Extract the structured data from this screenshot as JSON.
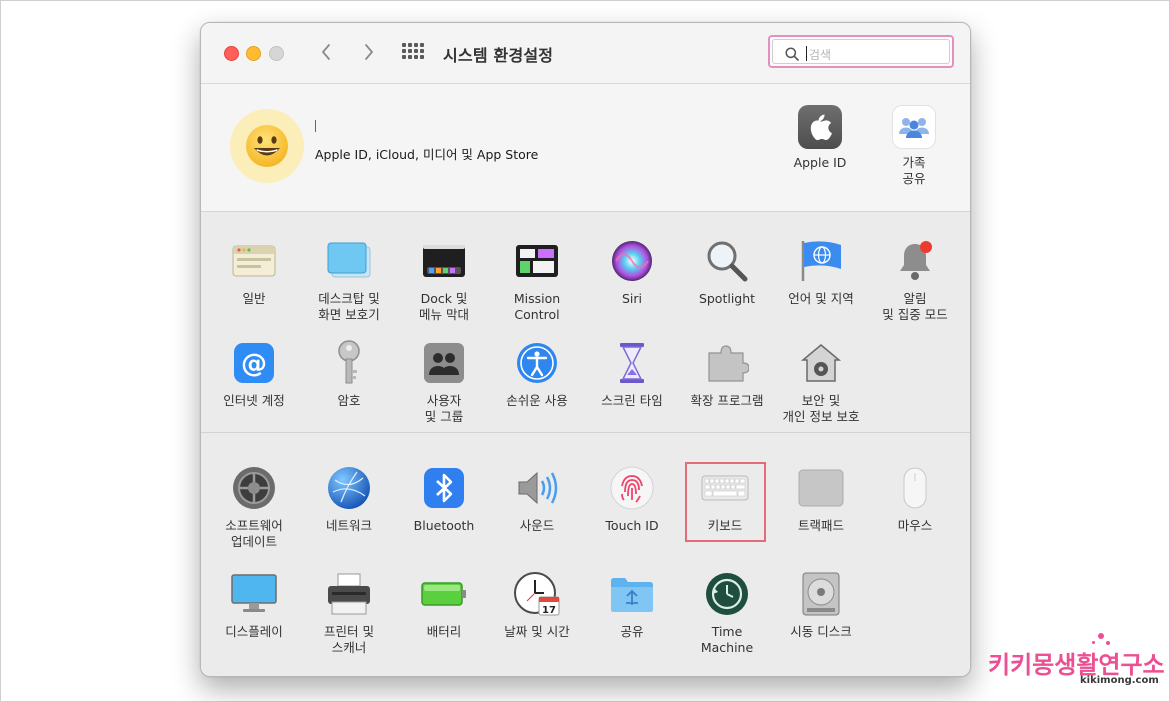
{
  "window": {
    "title": "시스템 환경설정",
    "search": {
      "placeholder": "검색",
      "value": ""
    }
  },
  "account": {
    "label": "Apple ID, iCloud, 미디어 및 App Store",
    "items": [
      {
        "label": "Apple ID",
        "icon": "apple-logo-icon"
      },
      {
        "label": "가족\n공유",
        "icon": "family-sharing-icon"
      }
    ]
  },
  "panes_row1": [
    {
      "label": "일반",
      "icon": "general-icon"
    },
    {
      "label": "데스크탑 및\n화면 보호기",
      "icon": "desktop-screensaver-icon"
    },
    {
      "label": "Dock 및\n메뉴 막대",
      "icon": "dock-menubar-icon"
    },
    {
      "label": "Mission\nControl",
      "icon": "mission-control-icon"
    },
    {
      "label": "Siri",
      "icon": "siri-icon"
    },
    {
      "label": "Spotlight",
      "icon": "spotlight-icon"
    },
    {
      "label": "언어 및 지역",
      "icon": "language-region-icon"
    },
    {
      "label": "알림\n및 집중 모드",
      "icon": "notifications-icon"
    }
  ],
  "panes_row2": [
    {
      "label": "인터넷 계정",
      "icon": "internet-accounts-icon"
    },
    {
      "label": "암호",
      "icon": "passwords-icon"
    },
    {
      "label": "사용자\n및 그룹",
      "icon": "users-groups-icon"
    },
    {
      "label": "손쉬운 사용",
      "icon": "accessibility-icon"
    },
    {
      "label": "스크린 타임",
      "icon": "screen-time-icon"
    },
    {
      "label": "확장 프로그램",
      "icon": "extensions-icon"
    },
    {
      "label": "보안 및\n개인 정보 보호",
      "icon": "security-privacy-icon"
    }
  ],
  "panes_row3": [
    {
      "label": "소프트웨어\n업데이트",
      "icon": "software-update-icon"
    },
    {
      "label": "네트워크",
      "icon": "network-icon"
    },
    {
      "label": "Bluetooth",
      "icon": "bluetooth-icon"
    },
    {
      "label": "사운드",
      "icon": "sound-icon"
    },
    {
      "label": "Touch ID",
      "icon": "touch-id-icon"
    },
    {
      "label": "키보드",
      "icon": "keyboard-icon",
      "highlighted": true
    },
    {
      "label": "트랙패드",
      "icon": "trackpad-icon"
    },
    {
      "label": "마우스",
      "icon": "mouse-icon"
    }
  ],
  "panes_row4": [
    {
      "label": "디스플레이",
      "icon": "displays-icon"
    },
    {
      "label": "프린터 및\n스캐너",
      "icon": "printers-scanners-icon"
    },
    {
      "label": "배터리",
      "icon": "battery-icon"
    },
    {
      "label": "날짜 및 시간",
      "icon": "date-time-icon",
      "badge": "17"
    },
    {
      "label": "공유",
      "icon": "sharing-icon"
    },
    {
      "label": "Time\nMachine",
      "icon": "time-machine-icon"
    },
    {
      "label": "시동 디스크",
      "icon": "startup-disk-icon"
    }
  ],
  "watermark": {
    "text": "키키몽생활연구소",
    "url": "kikimong.com"
  },
  "colors": {
    "highlight": "#e46c76",
    "search_focus": "#e58fc0",
    "watermark": "#ec4f92"
  }
}
